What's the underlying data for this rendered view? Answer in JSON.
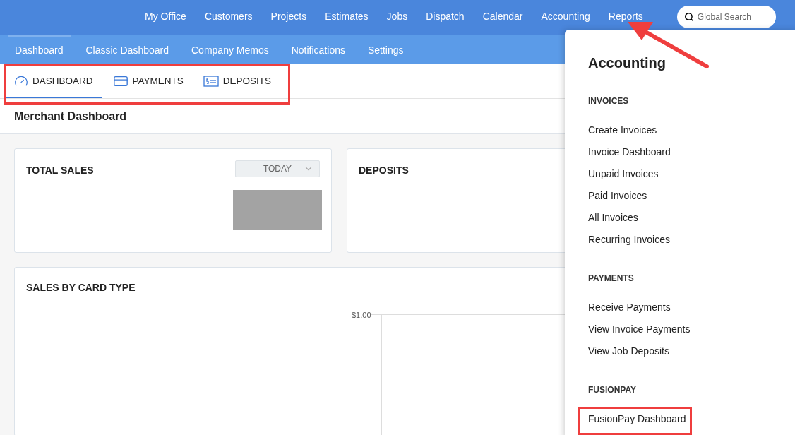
{
  "top_nav": {
    "items": [
      {
        "label": "My Office"
      },
      {
        "label": "Customers"
      },
      {
        "label": "Projects"
      },
      {
        "label": "Estimates"
      },
      {
        "label": "Jobs"
      },
      {
        "label": "Dispatch"
      },
      {
        "label": "Calendar"
      },
      {
        "label": "Accounting"
      },
      {
        "label": "Reports"
      }
    ],
    "search": {
      "placeholder": "Global Search"
    }
  },
  "sub_nav": [
    {
      "label": "Dashboard",
      "selected": true
    },
    {
      "label": "Classic Dashboard",
      "selected": false
    },
    {
      "label": "Company Memos",
      "selected": false
    },
    {
      "label": "Notifications",
      "selected": false
    },
    {
      "label": "Settings",
      "selected": false
    }
  ],
  "tabs": {
    "annotated": true,
    "items": [
      {
        "label": "DASHBOARD",
        "kind": "gauge",
        "selected": true
      },
      {
        "label": "PAYMENTS",
        "kind": "card",
        "selected": false
      },
      {
        "label": "DEPOSITS",
        "kind": "bill",
        "selected": false
      }
    ]
  },
  "page_title": "Merchant Dashboard",
  "cards": [
    {
      "title": "TOTAL SALES",
      "filter": "TODAY"
    },
    {
      "title": "DEPOSITS"
    }
  ],
  "sales_by_card_type": {
    "title": "SALES BY CARD TYPE",
    "y_tick": "$1.00"
  },
  "menu": {
    "title": "Accounting",
    "sections": [
      {
        "heading": "INVOICES",
        "items": [
          {
            "label": "Create Invoices",
            "annotated": false
          },
          {
            "label": "Invoice Dashboard",
            "annotated": false
          },
          {
            "label": "Unpaid Invoices",
            "annotated": false
          },
          {
            "label": "Paid Invoices",
            "annotated": false
          },
          {
            "label": "All Invoices",
            "annotated": false
          },
          {
            "label": "Recurring Invoices",
            "annotated": false
          }
        ]
      },
      {
        "heading": "PAYMENTS",
        "items": [
          {
            "label": "Receive Payments",
            "annotated": false
          },
          {
            "label": "View Invoice Payments",
            "annotated": false
          },
          {
            "label": "View Job Deposits",
            "annotated": false
          }
        ]
      },
      {
        "heading": "FUSIONPAY",
        "items": [
          {
            "label": "FusionPay Dashboard",
            "annotated": true
          }
        ]
      }
    ]
  }
}
